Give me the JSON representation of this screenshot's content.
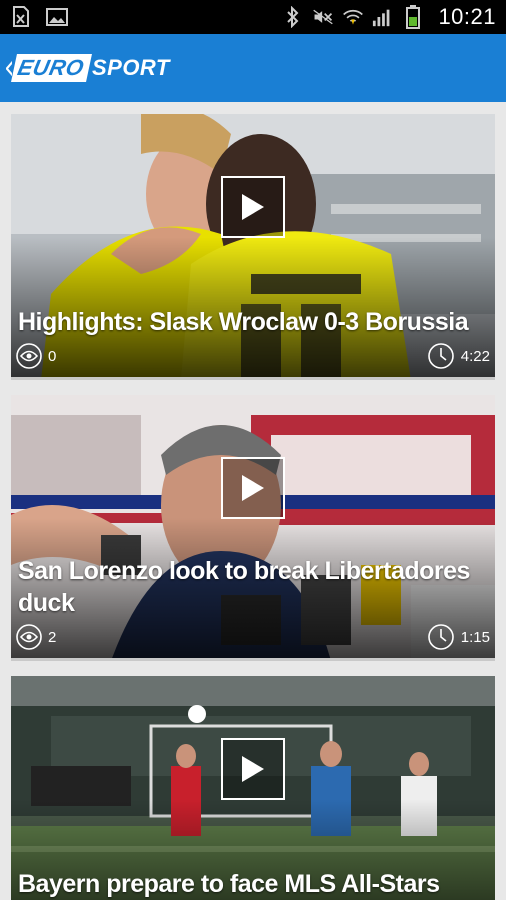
{
  "status_bar": {
    "time": "10:21",
    "left_icons": [
      "document-x-icon",
      "image-icon"
    ],
    "right_icons": [
      "bluetooth-icon",
      "mute-icon",
      "wifi-icon",
      "signal-icon",
      "battery-icon"
    ]
  },
  "app_bar": {
    "logo_euro": "EURO",
    "logo_sport": "SPORT"
  },
  "cards": [
    {
      "title": "Highlights: Slask Wroclaw 0-3 Borussia",
      "views": "0",
      "duration": "4:22"
    },
    {
      "title": "San Lorenzo look to break Libertadores duck",
      "views": "2",
      "duration": "1:15"
    },
    {
      "title": "Bayern prepare to face MLS All-Stars",
      "views": "",
      "duration": ""
    }
  ],
  "colors": {
    "brand": "#1a7fd4",
    "status_bar": "#000000"
  }
}
